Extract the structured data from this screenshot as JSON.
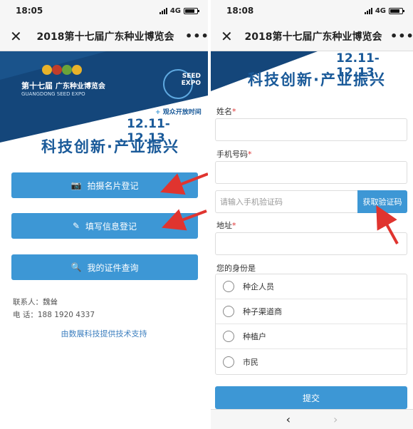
{
  "colors": {
    "accent": "#3d97d5",
    "banner_navy": "#14467a",
    "arrow": "#e0342f"
  },
  "left": {
    "status": {
      "time": "18:05",
      "network": "4G"
    },
    "nav": {
      "close": "✕",
      "title": "2018第十七届广东种业博览会",
      "more": "•••"
    },
    "banner": {
      "logo_title": "第十七届",
      "logo_sub": "广东种业博览会",
      "logo_en": "GUANGDONG SEED EXPO",
      "expo_badge_line1": "SEED",
      "expo_badge_line2": "EXPO",
      "open_label": "观众开放时间",
      "dates": "12.11-12.13",
      "slogan": "科技创新·产业振兴"
    },
    "buttons": [
      {
        "icon": "camera-icon",
        "label": "拍摄名片登记"
      },
      {
        "icon": "pencil-icon",
        "label": "填写信息登记"
      },
      {
        "icon": "search-icon",
        "label": "我的证件查询"
      }
    ],
    "contact": {
      "person": "联系人：魏耸",
      "phone": "电  话：188 1920 4337"
    },
    "support": "由数展科技提供技术支持"
  },
  "right": {
    "status": {
      "time": "18:08",
      "network": "4G"
    },
    "nav": {
      "close": "✕",
      "title": "2018第十七届广东种业博览会",
      "more": "•••"
    },
    "banner": {
      "dates": "12.11-12.13",
      "slogan": "科技创新·产业振兴"
    },
    "form": {
      "name_label": "姓名",
      "phone_label": "手机号码",
      "code_placeholder": "请输入手机验证码",
      "code_button": "获取验证码",
      "address_label": "地址",
      "identity_label": "您的身份是",
      "options": [
        "种企人员",
        "种子渠道商",
        "种植户",
        "市民"
      ],
      "submit": "提交"
    },
    "bottom": {
      "back": "‹",
      "forward": "›"
    }
  }
}
